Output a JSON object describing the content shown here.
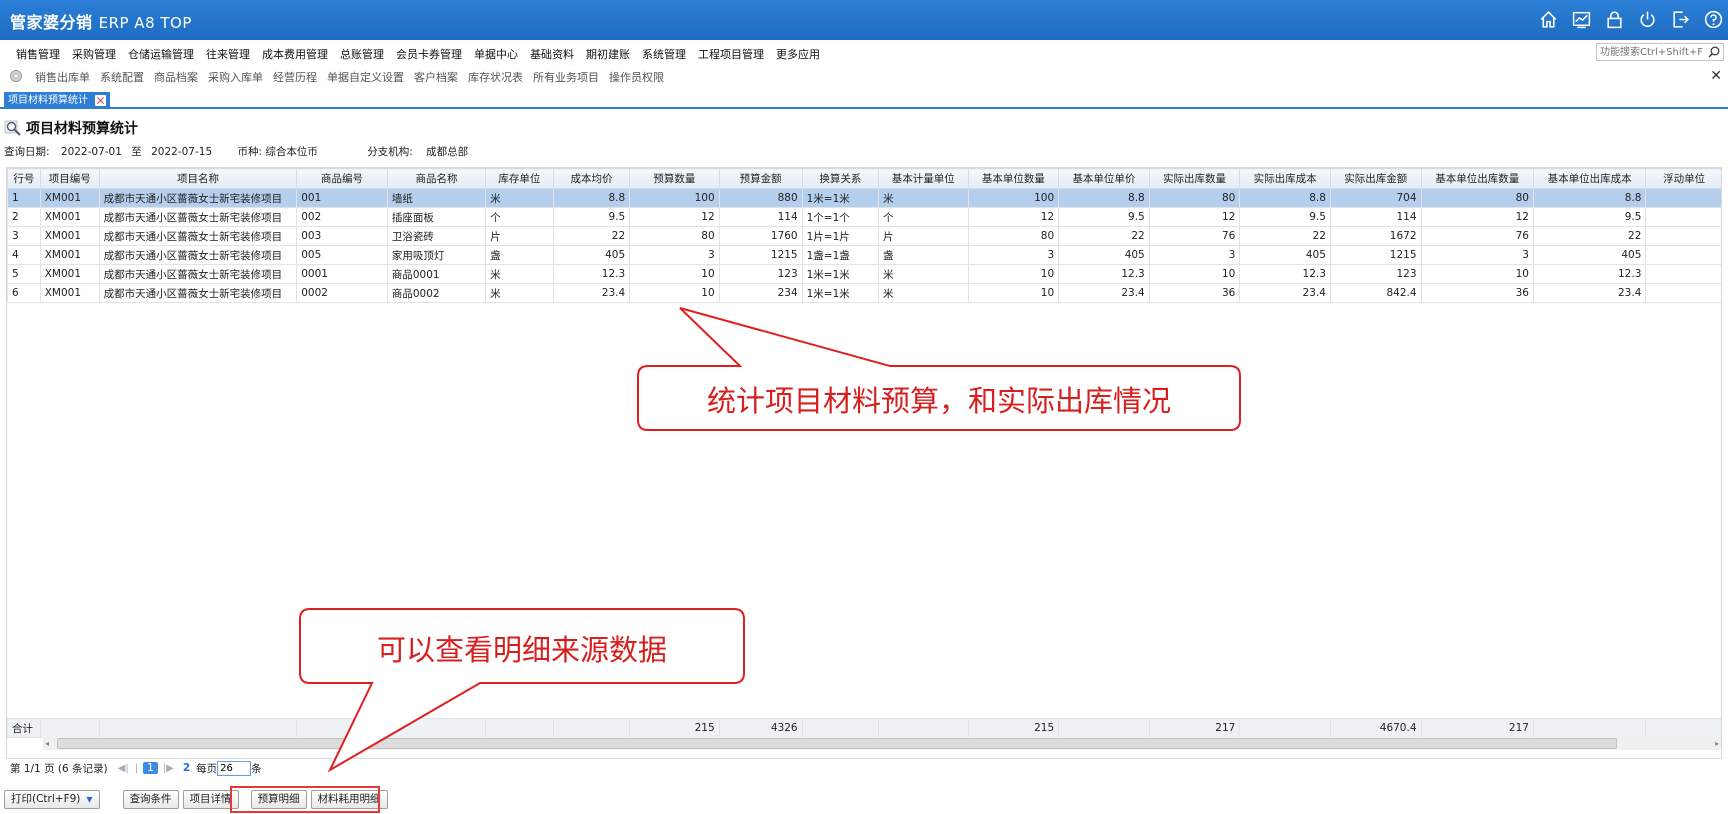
{
  "app": {
    "title_cn": "管家婆分销",
    "title_en": "ERP A8 TOP",
    "toolbar_icons": [
      "home-icon",
      "chart-icon",
      "lock-icon",
      "power-icon",
      "logout-icon",
      "help-icon"
    ]
  },
  "menu": [
    "销售管理",
    "采购管理",
    "仓储运输管理",
    "往来管理",
    "成本费用管理",
    "总账管理",
    "会员卡券管理",
    "单据中心",
    "基础资料",
    "期初建账",
    "系统管理",
    "工程项目管理",
    "更多应用"
  ],
  "search": {
    "placeholder": "功能搜索Ctrl+Shift+F"
  },
  "quick_links": [
    "销售出库单",
    "系统配置",
    "商品档案",
    "采购入库单",
    "经营历程",
    "单据自定义设置",
    "客户档案",
    "库存状况表",
    "所有业务项目",
    "操作员权限"
  ],
  "tab": {
    "label": "项目材料预算统计"
  },
  "page": {
    "title": "项目材料预算统计"
  },
  "filters": {
    "date_label": "查询日期:",
    "date_from": "2022-07-01",
    "date_to_label": "至",
    "date_to": "2022-07-15",
    "currency_label": "币种:",
    "currency": "综合本位币",
    "branch_label": "分支机构:",
    "branch": "成都总部"
  },
  "table": {
    "columns": [
      "行号",
      "项目编号",
      "项目名称",
      "商品编号",
      "商品名称",
      "库存单位",
      "成本均价",
      "预算数量",
      "预算金额",
      "换算关系",
      "基本计量单位",
      "基本单位数量",
      "基本单位单价",
      "实际出库数量",
      "实际出库成本",
      "实际出库金额",
      "基本单位出库数量",
      "基本单位出库成本",
      "浮动单位"
    ],
    "rows": [
      [
        "1",
        "XM001",
        "成都市天通小区蔷薇女士新宅装修项目",
        "001",
        "墙纸",
        "米",
        "8.8",
        "100",
        "880",
        "1米=1米",
        "米",
        "100",
        "8.8",
        "80",
        "8.8",
        "704",
        "80",
        "8.8",
        ""
      ],
      [
        "2",
        "XM001",
        "成都市天通小区蔷薇女士新宅装修项目",
        "002",
        "插座面板",
        "个",
        "9.5",
        "12",
        "114",
        "1个=1个",
        "个",
        "12",
        "9.5",
        "12",
        "9.5",
        "114",
        "12",
        "9.5",
        ""
      ],
      [
        "3",
        "XM001",
        "成都市天通小区蔷薇女士新宅装修项目",
        "003",
        "卫浴瓷砖",
        "片",
        "22",
        "80",
        "1760",
        "1片=1片",
        "片",
        "80",
        "22",
        "76",
        "22",
        "1672",
        "76",
        "22",
        ""
      ],
      [
        "4",
        "XM001",
        "成都市天通小区蔷薇女士新宅装修项目",
        "005",
        "家用吸顶灯",
        "盏",
        "405",
        "3",
        "1215",
        "1盏=1盏",
        "盏",
        "3",
        "405",
        "3",
        "405",
        "1215",
        "3",
        "405",
        ""
      ],
      [
        "5",
        "XM001",
        "成都市天通小区蔷薇女士新宅装修项目",
        "0001",
        "商品0001",
        "米",
        "12.3",
        "10",
        "123",
        "1米=1米",
        "米",
        "10",
        "12.3",
        "10",
        "12.3",
        "123",
        "10",
        "12.3",
        ""
      ],
      [
        "6",
        "XM001",
        "成都市天通小区蔷薇女士新宅装修项目",
        "0002",
        "商品0002",
        "米",
        "23.4",
        "10",
        "234",
        "1米=1米",
        "米",
        "10",
        "23.4",
        "36",
        "23.4",
        "842.4",
        "36",
        "23.4",
        ""
      ]
    ],
    "selected_row": 0,
    "totals": [
      "合计",
      "",
      "",
      "",
      "",
      "",
      "",
      "215",
      "4326",
      "",
      "",
      "215",
      "",
      "217",
      "",
      "4670.4",
      "217",
      "",
      ""
    ]
  },
  "pager": {
    "page_info": "第 1/1 页 (6 条记录)",
    "current": "1",
    "next": "2",
    "per_page_label": "每页",
    "per_page": "26",
    "unit": "条"
  },
  "buttons": {
    "print": "打印(Ctrl+F9)",
    "query": "查询条件",
    "detail": "项目详情",
    "budget_detail": "预算明细",
    "material_detail": "材料耗用明细"
  },
  "annotations": {
    "callout1": "统计项目材料预算，和实际出库情况",
    "callout2": "可以查看明细来源数据",
    "accent_color": "#e02020"
  }
}
